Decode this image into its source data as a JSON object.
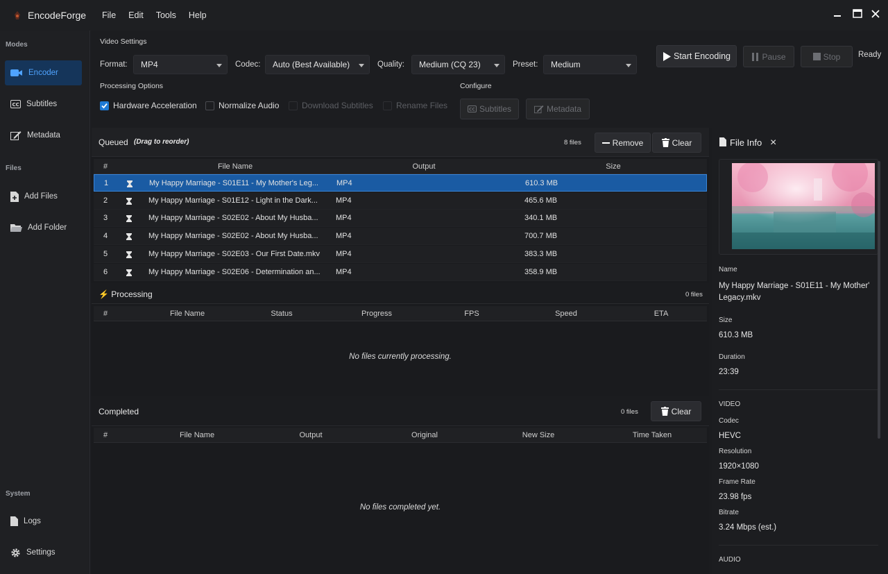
{
  "app": {
    "title": "EncodeForge",
    "menu": [
      "File",
      "Edit",
      "Tools",
      "Help"
    ],
    "accent": "#1f7ad6"
  },
  "sidebar": {
    "modes_label": "Modes",
    "modes": [
      {
        "label": "Encoder",
        "icon": "video-camera-icon",
        "active": true
      },
      {
        "label": "Subtitles",
        "icon": "cc-icon"
      },
      {
        "label": "Metadata",
        "icon": "edit-icon"
      }
    ],
    "files_label": "Files",
    "files": [
      {
        "label": "Add Files",
        "icon": "add-file-icon"
      },
      {
        "label": "Add Folder",
        "icon": "folder-icon"
      }
    ],
    "system_label": "System",
    "system": [
      {
        "label": "Logs",
        "icon": "document-icon"
      },
      {
        "label": "Settings",
        "icon": "gear-icon"
      }
    ]
  },
  "settings": {
    "video_settings_label": "Video Settings",
    "format_label": "Format:",
    "format_value": "MP4",
    "codec_label": "Codec:",
    "codec_value": "Auto (Best Available)",
    "quality_label": "Quality:",
    "quality_value": "Medium (CQ 23)",
    "preset_label": "Preset:",
    "preset_value": "Medium",
    "processing_options_label": "Processing Options",
    "hardware_acceleration": {
      "label": "Hardware Acceleration",
      "checked": true
    },
    "normalize_audio": {
      "label": "Normalize Audio",
      "checked": false
    },
    "download_subtitles": {
      "label": "Download Subtitles",
      "checked": false
    },
    "rename_files": {
      "label": "Rename Files",
      "checked": false
    },
    "configure_label": "Configure",
    "configure_subtitles": "Subtitles",
    "configure_metadata": "Metadata"
  },
  "actions": {
    "start": "Start Encoding",
    "pause": "Pause",
    "stop": "Stop",
    "status": "Ready"
  },
  "queued": {
    "title": "Queued",
    "hint": "(Drag to reorder)",
    "count": "8 files",
    "remove": "Remove",
    "clear": "Clear",
    "columns": [
      "#",
      "File Name",
      "Output",
      "Size"
    ],
    "rows": [
      {
        "n": "1",
        "name": "My Happy Marriage - S01E11 - My Mother's Leg...",
        "output": "MP4",
        "size": "610.3 MB"
      },
      {
        "n": "2",
        "name": "My Happy Marriage - S01E12 - Light in the Dark...",
        "output": "MP4",
        "size": "465.6 MB"
      },
      {
        "n": "3",
        "name": "My Happy Marriage - S02E02 - About My Husba...",
        "output": "MP4",
        "size": "340.1 MB"
      },
      {
        "n": "4",
        "name": "My Happy Marriage - S02E02 - About My Husba...",
        "output": "MP4",
        "size": "700.7 MB"
      },
      {
        "n": "5",
        "name": "My Happy Marriage - S02E03 - Our First Date.mkv",
        "output": "MP4",
        "size": "383.3 MB"
      },
      {
        "n": "6",
        "name": "My Happy Marriage - S02E06 - Determination an...",
        "output": "MP4",
        "size": "358.9 MB"
      }
    ]
  },
  "processing": {
    "title": "⚡ Processing",
    "count": "0 files",
    "columns": [
      "#",
      "File Name",
      "Status",
      "Progress",
      "FPS",
      "Speed",
      "ETA"
    ],
    "empty": "No files currently processing."
  },
  "completed": {
    "title": "Completed",
    "count": "0 files",
    "clear": "Clear",
    "columns": [
      "#",
      "File Name",
      "Output",
      "Original",
      "New Size",
      "Time Taken"
    ],
    "empty": "No files completed yet."
  },
  "file_info": {
    "title": "File Info",
    "close": "×",
    "name_label": "Name",
    "name_value": "My Happy Marriage - S01E11 - My Mother' Legacy.mkv",
    "name_line1": "My Happy Marriage - S01E11 - My Mother'",
    "name_line2": "Legacy.mkv",
    "size_label": "Size",
    "size_value": "610.3 MB",
    "duration_label": "Duration",
    "duration_value": "23:39",
    "video_label": "VIDEO",
    "codec_label": "Codec",
    "codec_value": "HEVC",
    "resolution_label": "Resolution",
    "resolution_value": "1920×1080",
    "framerate_label": "Frame Rate",
    "framerate_value": "23.98 fps",
    "bitrate_label": "Bitrate",
    "bitrate_value": "3.24 Mbps (est.)",
    "audio_label": "AUDIO"
  }
}
